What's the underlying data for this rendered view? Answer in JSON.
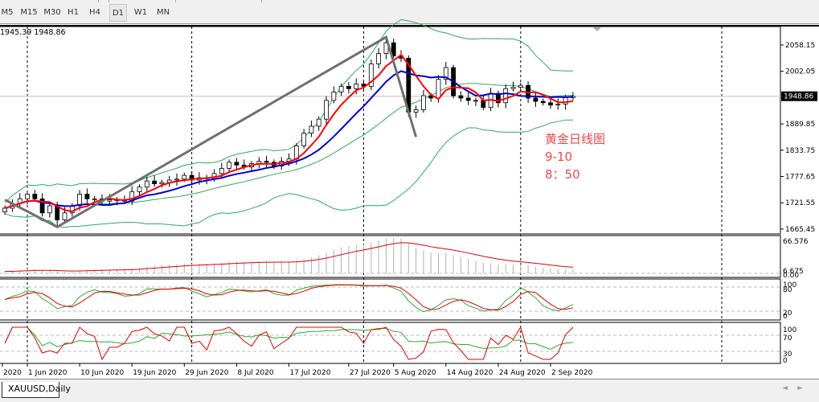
{
  "toolbar": {
    "timeframes": [
      "M5",
      "M15",
      "M30",
      "H1",
      "H4",
      "D1",
      "W1",
      "MN"
    ],
    "active": "D1"
  },
  "bid_ask": "1945.39 1948.86",
  "annotation": {
    "line1": "黄金日线图",
    "line2": "9-10",
    "line3": "8：50"
  },
  "symbol_tab": "XAUUSD,Daily",
  "colors": {
    "ma_fast": "#ff0000",
    "ma_slow": "#0000cc",
    "bands": "#2eaa5a",
    "zigzag": "#707070",
    "annotation": "#f04848"
  },
  "chart_data": {
    "type": "candlestick",
    "symbol": "XAUUSD",
    "timeframe": "Daily",
    "price_ticks": [
      "2058.15",
      "2002.05",
      "1889.85",
      "1833.75",
      "1777.65",
      "1721.55",
      "1665.45"
    ],
    "current_price": "1948.86",
    "ylim": [
      1665.45,
      2090
    ],
    "date_ticks": [
      "2020",
      "1 Jun 2020",
      "10 Jun 2020",
      "19 Jun 2020",
      "29 Jun 2020",
      "8 Jul 2020",
      "17 Jul 2020",
      "27 Jul 2020",
      "5 Aug 2020",
      "14 Aug 2020",
      "24 Aug 2020",
      "2 Sep 2020"
    ],
    "date_tick_index": [
      0,
      3,
      10,
      17,
      24,
      31,
      38,
      46,
      52,
      59,
      66,
      73
    ],
    "month_separator_index": [
      3,
      25,
      48,
      69
    ],
    "closes": [
      1710,
      1720,
      1730,
      1740,
      1730,
      1700,
      1715,
      1685,
      1700,
      1715,
      1740,
      1730,
      1730,
      1725,
      1728,
      1728,
      1725,
      1745,
      1755,
      1768,
      1762,
      1765,
      1770,
      1772,
      1780,
      1770,
      1775,
      1773,
      1784,
      1795,
      1808,
      1802,
      1798,
      1805,
      1810,
      1808,
      1800,
      1810,
      1815,
      1843,
      1870,
      1885,
      1900,
      1940,
      1958,
      1970,
      1965,
      1975,
      1970,
      2018,
      2040,
      2063,
      2035,
      2030,
      1915,
      1920,
      1950,
      1945,
      1985,
      2010,
      1950,
      1945,
      1940,
      1940,
      1925,
      1955,
      1935,
      1965,
      1968,
      1972,
      1945,
      1938,
      1935,
      1930,
      1932,
      1946,
      1948.86
    ],
    "zigzag": [
      {
        "index": 0,
        "price": 1728
      },
      {
        "index": 7,
        "price": 1670
      },
      {
        "index": 51,
        "price": 2075
      },
      {
        "index": 55,
        "price": 1862
      }
    ],
    "indicators": {
      "moving_averages": [
        "MA 5",
        "MA 10"
      ],
      "bands": "Bollinger 20",
      "panel1": {
        "name": "MACD histogram",
        "ticks": [
          "66.576",
          "6.675",
          "0.00"
        ]
      },
      "panel2": {
        "name": "Stochastic",
        "ticks": [
          "100",
          "80",
          "20",
          "0"
        ]
      },
      "panel3": {
        "name": "RSI",
        "ticks": [
          "100",
          "70",
          "30",
          "0"
        ]
      }
    }
  }
}
